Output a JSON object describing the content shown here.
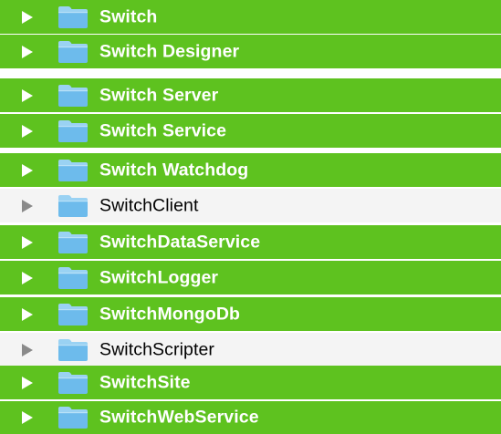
{
  "colors": {
    "selected_bg": "#5ec21f",
    "normal_bg": "#f4f4f4",
    "selected_text": "#ffffff",
    "normal_text": "#000000",
    "folder_fill": "#6dbbec",
    "folder_tab": "#9ad2f3"
  },
  "items": [
    {
      "label": "Switch",
      "selected": true,
      "icon": "folder-icon",
      "disclosure": "triangle-right-icon"
    },
    {
      "label": "Switch Designer",
      "selected": true,
      "icon": "folder-icon",
      "disclosure": "triangle-right-icon"
    },
    {
      "label": "Switch Server",
      "selected": true,
      "icon": "folder-icon",
      "disclosure": "triangle-right-icon"
    },
    {
      "label": "Switch Service",
      "selected": true,
      "icon": "folder-icon",
      "disclosure": "triangle-right-icon"
    },
    {
      "label": "Switch Watchdog",
      "selected": true,
      "icon": "folder-icon",
      "disclosure": "triangle-right-icon"
    },
    {
      "label": "SwitchClient",
      "selected": false,
      "icon": "folder-icon",
      "disclosure": "triangle-right-icon"
    },
    {
      "label": "SwitchDataService",
      "selected": true,
      "icon": "folder-icon",
      "disclosure": "triangle-right-icon"
    },
    {
      "label": "SwitchLogger",
      "selected": true,
      "icon": "folder-icon",
      "disclosure": "triangle-right-icon"
    },
    {
      "label": "SwitchMongoDb",
      "selected": true,
      "icon": "folder-icon",
      "disclosure": "triangle-right-icon"
    },
    {
      "label": "SwitchScripter",
      "selected": false,
      "icon": "folder-icon",
      "disclosure": "triangle-right-icon"
    },
    {
      "label": "SwitchSite",
      "selected": true,
      "icon": "folder-icon",
      "disclosure": "triangle-right-icon"
    },
    {
      "label": "SwitchWebService",
      "selected": true,
      "icon": "folder-icon",
      "disclosure": "triangle-right-icon"
    }
  ]
}
